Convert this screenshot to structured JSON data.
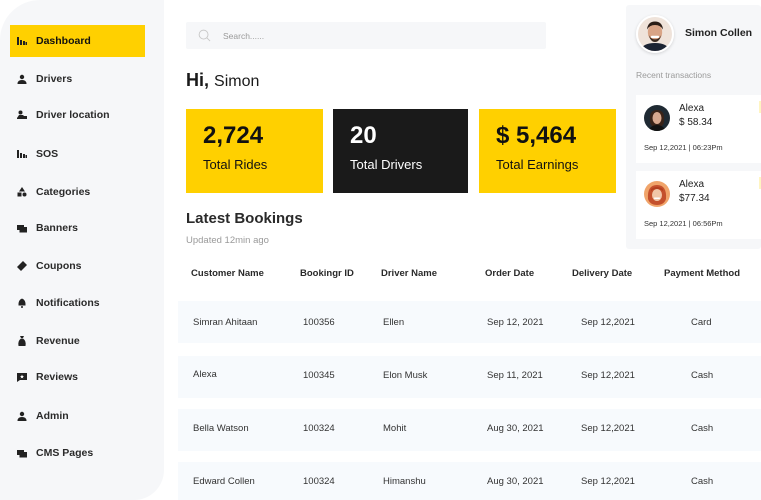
{
  "sidebar": {
    "items": [
      {
        "label": "Dashboard",
        "icon": "chart-bars-icon",
        "active": true
      },
      {
        "label": "Drivers",
        "icon": "person-icon",
        "active": false
      },
      {
        "label": "Driver location",
        "icon": "driver-location-icon",
        "active": false
      },
      {
        "label": "SOS",
        "icon": "chart-bars-icon",
        "active": false
      },
      {
        "label": "Categories",
        "icon": "categories-icon",
        "active": false
      },
      {
        "label": "Banners",
        "icon": "banners-icon",
        "active": false
      },
      {
        "label": "Coupons",
        "icon": "ticket-icon",
        "active": false
      },
      {
        "label": "Notifications",
        "icon": "bell-icon",
        "active": false
      },
      {
        "label": "Revenue",
        "icon": "money-bag-icon",
        "active": false
      },
      {
        "label": "Reviews",
        "icon": "review-star-icon",
        "active": false
      },
      {
        "label": "Admin",
        "icon": "person-icon",
        "active": false
      },
      {
        "label": "CMS Pages",
        "icon": "pages-icon",
        "active": false
      }
    ]
  },
  "search": {
    "placeholder": "Search......",
    "value": ""
  },
  "greeting": {
    "hi": "Hi,",
    "name": "Simon"
  },
  "stats": [
    {
      "value": "2,724",
      "label": "Total Rides"
    },
    {
      "value": "20",
      "label": "Total Drivers"
    },
    {
      "value": "$ 5,464",
      "label": "Total Earnings"
    }
  ],
  "bookings": {
    "title": "Latest Bookings",
    "subtitle": "Updated 12min ago",
    "columns": [
      "Customer Name",
      "Bookingr ID",
      "Driver Name",
      "Order Date",
      "Delivery Date",
      "Payment Method"
    ],
    "rows": [
      [
        "Simran Ahitaan",
        "100356",
        "Ellen",
        "Sep 12, 2021",
        "Sep 12,2021",
        "Card"
      ],
      [
        "Alexa",
        "100345",
        "Elon Musk",
        "Sep 11, 2021",
        "Sep 12,2021",
        "Cash"
      ],
      [
        "Bella Watson",
        "100324",
        "Mohit",
        "Aug 30, 2021",
        "Sep 12,2021",
        "Cash"
      ],
      [
        "Edward Collen",
        "100324",
        "Himanshu",
        "Aug 30, 2021",
        "Sep 12,2021",
        "Cash"
      ]
    ]
  },
  "profile": {
    "name": "Simon Collen"
  },
  "transactions": {
    "label": "Recent transactions",
    "items": [
      {
        "name": "Alexa",
        "amount": "$ 58.34",
        "datetime": "Sep 12,2021 | 06:23Pm"
      },
      {
        "name": "Alexa",
        "amount": "$77.34",
        "datetime": "Sep 12,2021 | 06:56Pm"
      }
    ]
  },
  "colors": {
    "accent": "#ffd000",
    "dark": "#1a1a1a",
    "panel": "#f6f7f9",
    "row": "#f7fafd"
  }
}
